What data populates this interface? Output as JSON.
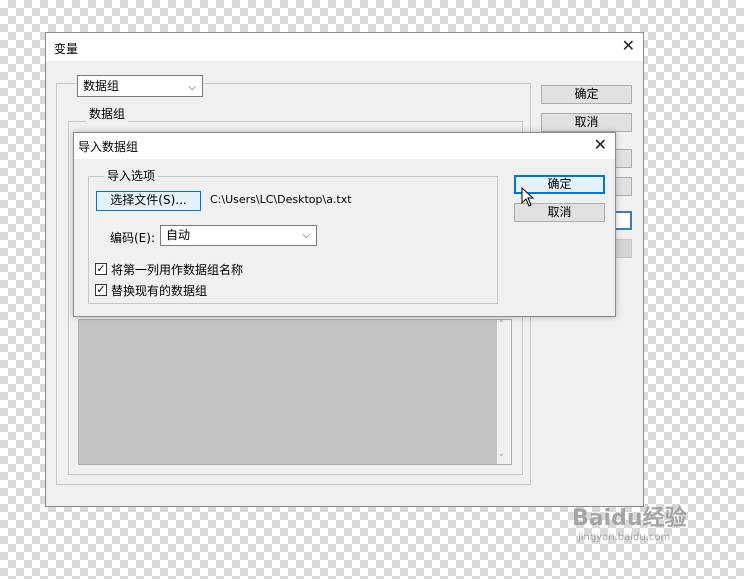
{
  "variables_dialog": {
    "title": "变量",
    "dropdown_value": "数据组",
    "group_label": "数据组",
    "buttons": [
      "确定",
      "取消"
    ]
  },
  "import_dialog": {
    "title": "导入数据组",
    "options_label": "导入选项",
    "choose_file_label": "选择文件(S)...",
    "file_path": "C:\\Users\\LC\\Desktop\\a.txt",
    "encoding_label": "编码(E):",
    "encoding_value": "自动",
    "checkbox_first_column": "将第一列用作数据组名称",
    "checkbox_replace": "替换现有的数据组",
    "ok_label": "确定",
    "cancel_label": "取消"
  },
  "watermark": {
    "text": "Baidu经验",
    "sub": "jingyan.baidu.com"
  }
}
